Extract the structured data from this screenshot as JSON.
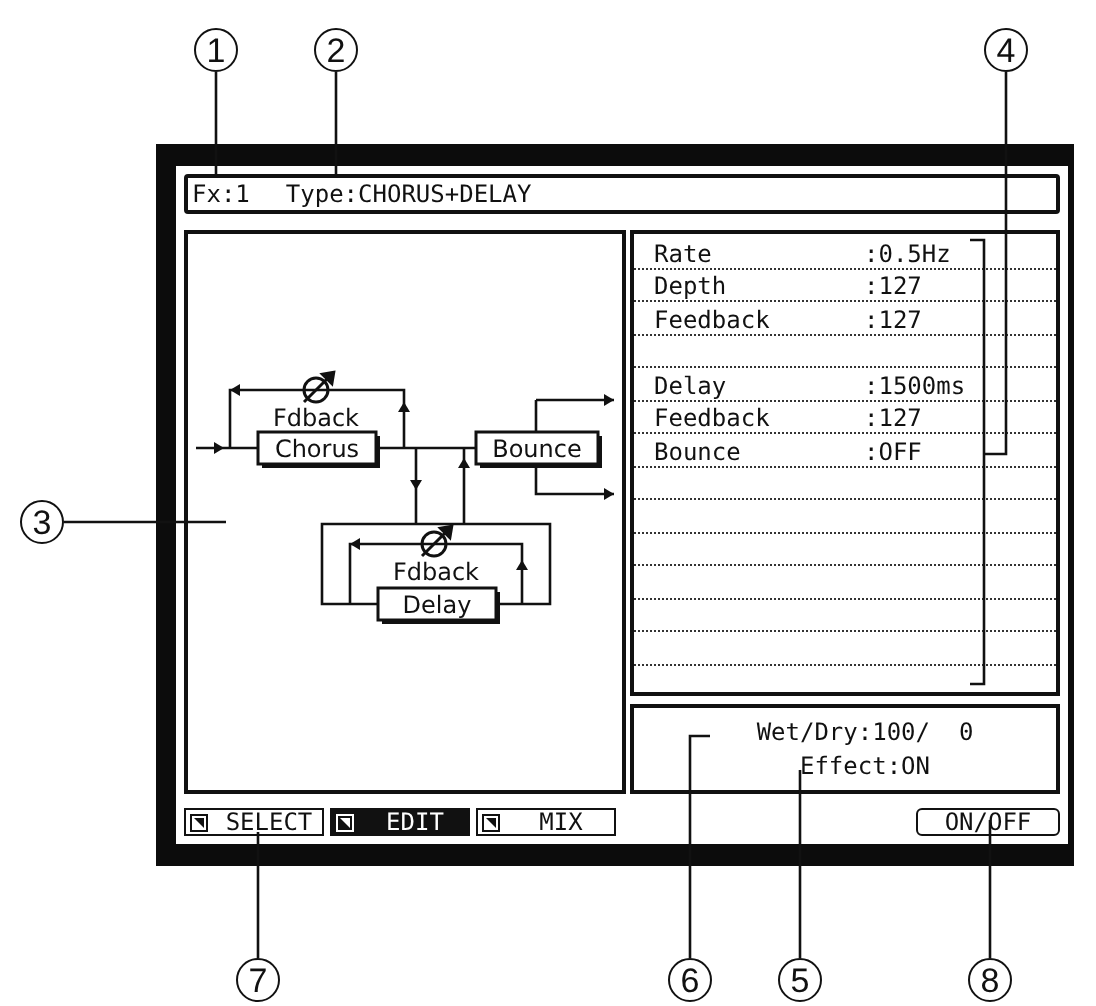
{
  "header": {
    "fx": "Fx:1",
    "type": "Type:CHORUS+DELAY"
  },
  "diagram": {
    "blocks": [
      "Chorus",
      "Bounce",
      "Delay"
    ],
    "feedback_labels": [
      "Fdback",
      "Fdback"
    ]
  },
  "parameter_groups": [
    [
      {
        "name": "Rate",
        "value": ":0.5Hz"
      },
      {
        "name": "Depth",
        "value": ":127"
      },
      {
        "name": "Feedback",
        "value": ":127"
      }
    ],
    [
      {
        "name": "Delay",
        "value": ":1500ms"
      },
      {
        "name": "Feedback",
        "value": ":127"
      },
      {
        "name": "Bounce",
        "value": ":OFF"
      }
    ]
  ],
  "mix": {
    "wet_dry": "Wet/Dry:100/  0",
    "effect": "Effect:ON"
  },
  "tabs": [
    {
      "label": "SELECT",
      "selected": false
    },
    {
      "label": "EDIT",
      "selected": true
    },
    {
      "label": "MIX",
      "selected": false
    }
  ],
  "on_off_button": "ON/OFF",
  "callouts": [
    "1",
    "2",
    "4",
    "3",
    "7",
    "6",
    "5",
    "8"
  ]
}
